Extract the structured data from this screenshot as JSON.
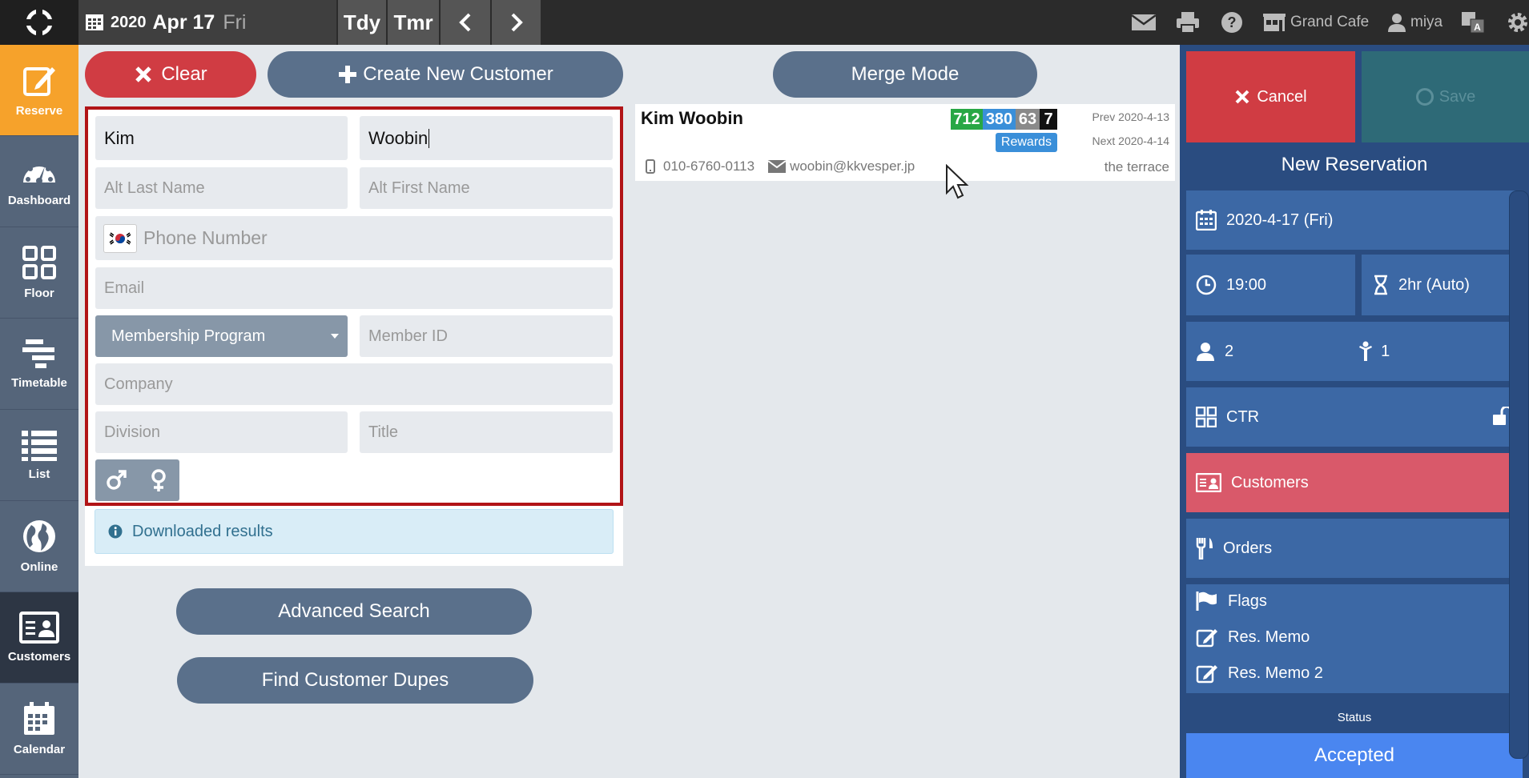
{
  "topbar": {
    "year": "2020",
    "monthday": "Apr 17",
    "weekday": "Fri",
    "today_label": "Tdy",
    "tomorrow_label": "Tmr",
    "restaurant": "Grand Cafe",
    "user": "miya"
  },
  "sidebar": {
    "items": [
      {
        "label": "Reserve",
        "icon": "edit-icon"
      },
      {
        "label": "Dashboard",
        "icon": "gauge-icon"
      },
      {
        "label": "Floor",
        "icon": "grid-icon"
      },
      {
        "label": "Timetable",
        "icon": "timetable-icon"
      },
      {
        "label": "List",
        "icon": "list-icon"
      },
      {
        "label": "Online",
        "icon": "globe-icon"
      },
      {
        "label": "Customers",
        "icon": "id-card-icon"
      },
      {
        "label": "Calendar",
        "icon": "calendar-icon"
      }
    ]
  },
  "actions": {
    "clear": "Clear",
    "create": "Create New Customer",
    "merge": "Merge Mode",
    "advanced": "Advanced Search",
    "dupes": "Find Customer Dupes"
  },
  "form": {
    "last_name": "Kim",
    "first_name": "Woobin",
    "alt_last_placeholder": "Alt Last Name",
    "alt_first_placeholder": "Alt First Name",
    "phone_placeholder": "Phone Number",
    "email_placeholder": "Email",
    "membership": "Membership Program",
    "member_id_placeholder": "Member ID",
    "company_placeholder": "Company",
    "division_placeholder": "Division",
    "title_placeholder": "Title",
    "info": "Downloaded results"
  },
  "result": {
    "name": "Kim Woobin",
    "badges": [
      "712",
      "380",
      "63",
      "7"
    ],
    "rewards": "Rewards",
    "prev": "Prev 2020-4-13",
    "next": "Next 2020-4-14",
    "phone": "010-6760-0113",
    "email": "woobin@kkvesper.jp",
    "area": "the terrace"
  },
  "panel": {
    "cancel": "Cancel",
    "save": "Save",
    "title": "New Reservation",
    "date": "2020-4-17 (Fri)",
    "time": "19:00",
    "duration": "2hr (Auto)",
    "adults": "2",
    "children": "1",
    "table": "CTR",
    "customers": "Customers",
    "orders": "Orders",
    "flags": "Flags",
    "memo1": "Res. Memo",
    "memo2": "Res. Memo 2",
    "status_label": "Status",
    "status": "Accepted"
  },
  "colors": {
    "accent_orange": "#f6a22b",
    "danger_red": "#d03c43",
    "slate": "#5a708b",
    "panel_blue": "#3c68a5",
    "badge_green": "#28a745",
    "badge_blue": "#3a8fd9",
    "badge_gray": "#8a8a8a",
    "badge_black": "#111111"
  }
}
